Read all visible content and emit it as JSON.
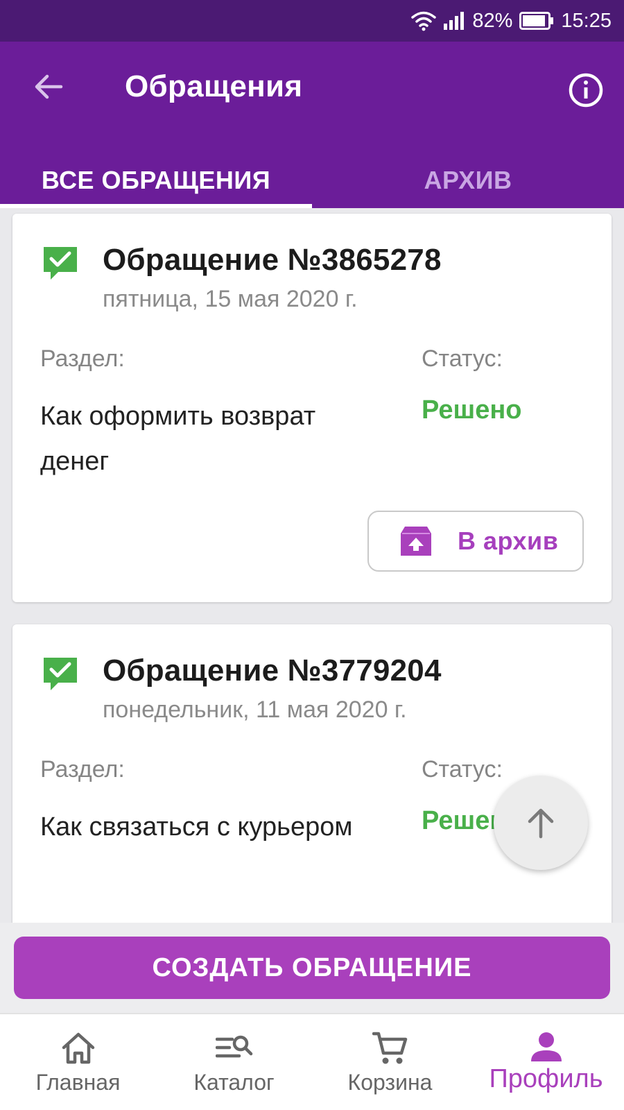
{
  "status_bar": {
    "battery": "82%",
    "time": "15:25"
  },
  "header": {
    "title": "Обращения"
  },
  "tabs": [
    {
      "label": "ВСЕ ОБРАЩЕНИЯ",
      "active": true
    },
    {
      "label": "АРХИВ",
      "active": false
    }
  ],
  "tickets": [
    {
      "title": "Обращение №3865278",
      "date": "пятница, 15 мая 2020 г.",
      "section_label": "Раздел:",
      "section": "Как оформить возврат денег",
      "status_label": "Статус:",
      "status": "Решено",
      "archive_label": "В архив"
    },
    {
      "title": "Обращение №3779204",
      "date": "понедельник, 11 мая 2020 г.",
      "section_label": "Раздел:",
      "section": "Как связаться с курьером",
      "status_label": "Статус:",
      "status": "Решено"
    }
  ],
  "create_button": "СОЗДАТЬ ОБРАЩЕНИЕ",
  "bottom_nav": [
    {
      "label": "Главная",
      "icon": "home-icon"
    },
    {
      "label": "Каталог",
      "icon": "catalog-search-icon"
    },
    {
      "label": "Корзина",
      "icon": "cart-icon"
    },
    {
      "label": "Профиль",
      "icon": "profile-icon",
      "active": true
    }
  ],
  "colors": {
    "status_bar": "#4b1a73",
    "app_bar": "#6b1d99",
    "accent": "#a940bc",
    "status_resolved": "#49b04a"
  }
}
